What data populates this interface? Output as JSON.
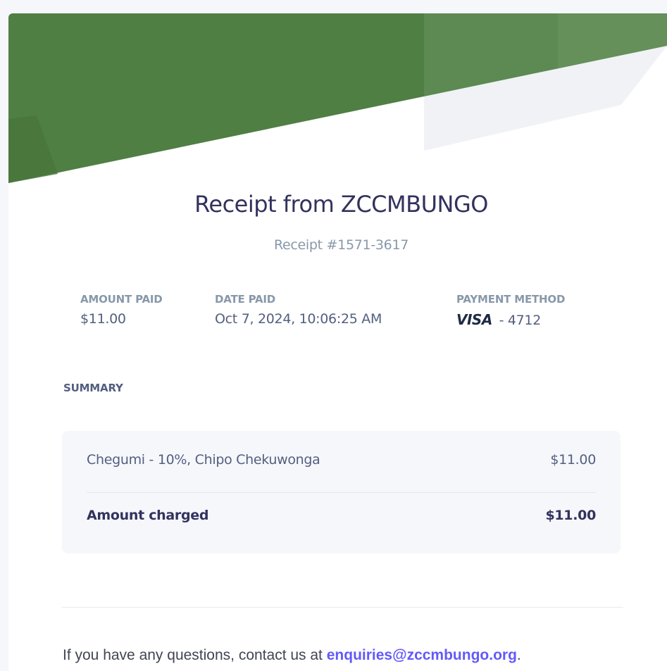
{
  "receipt": {
    "title": "Receipt from ZCCMBUNGO",
    "number": "Receipt #1571-3617"
  },
  "meta": {
    "amount_paid_label": "AMOUNT PAID",
    "amount_paid_value": "$11.00",
    "date_paid_label": "DATE PAID",
    "date_paid_value": "Oct 7, 2024, 10:06:25 AM",
    "payment_method_label": "PAYMENT METHOD",
    "card_brand": "VISA",
    "card_last4": "- 4712"
  },
  "summary": {
    "label": "SUMMARY",
    "item_description": "Chegumi - 10%, Chipo Chekuwonga",
    "item_amount": "$11.00",
    "total_label": "Amount charged",
    "total_amount": "$11.00"
  },
  "footer": {
    "text_prefix": "If you have any questions, contact us at ",
    "email": "enquiries@zccmbungo.org",
    "text_suffix": "."
  },
  "colors": {
    "banner_green": "#4f7f43",
    "link": "#625afa"
  }
}
